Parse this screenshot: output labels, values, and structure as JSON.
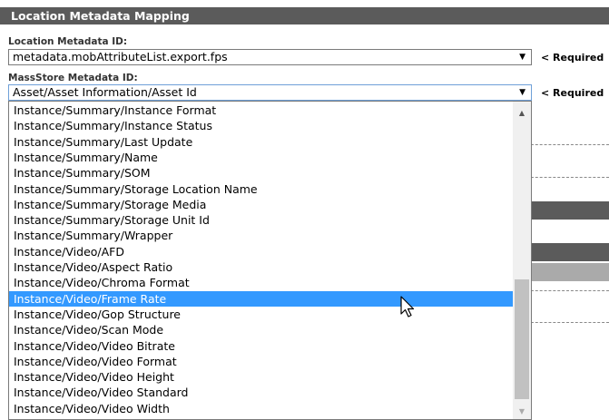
{
  "header": {
    "title": "Location Metadata Mapping"
  },
  "location_field": {
    "label": "Location Metadata ID:",
    "value": "metadata.mobAttributeList.export.fps",
    "required": "< Required"
  },
  "massstore_field": {
    "label": "MassStore Metadata ID:",
    "value": "Asset/Asset Information/Asset Id",
    "required": "< Required"
  },
  "dropdown": {
    "items": [
      "Instance/Summary/Instance Format",
      "Instance/Summary/Instance Status",
      "Instance/Summary/Last Update",
      "Instance/Summary/Name",
      "Instance/Summary/SOM",
      "Instance/Summary/Storage Location Name",
      "Instance/Summary/Storage Media",
      "Instance/Summary/Storage Unit Id",
      "Instance/Summary/Wrapper",
      "Instance/Video/AFD",
      "Instance/Video/Aspect Ratio",
      "Instance/Video/Chroma Format",
      "Instance/Video/Frame Rate",
      "Instance/Video/Gop Structure",
      "Instance/Video/Scan Mode",
      "Instance/Video/Video Bitrate",
      "Instance/Video/Video Format",
      "Instance/Video/Video Height",
      "Instance/Video/Video Standard",
      "Instance/Video/Video Width"
    ],
    "selected_item": "Instance/Video/Frame Rate"
  },
  "colors": {
    "header_bg": "#5b5b5b",
    "selection": "#3399ff",
    "focus_border": "#6fa0d8"
  },
  "icons": {
    "select_arrow": "chevron-down-icon",
    "scroll_up": "scroll-up-icon",
    "scroll_down": "scroll-down-icon",
    "cursor": "mouse-pointer-icon"
  }
}
